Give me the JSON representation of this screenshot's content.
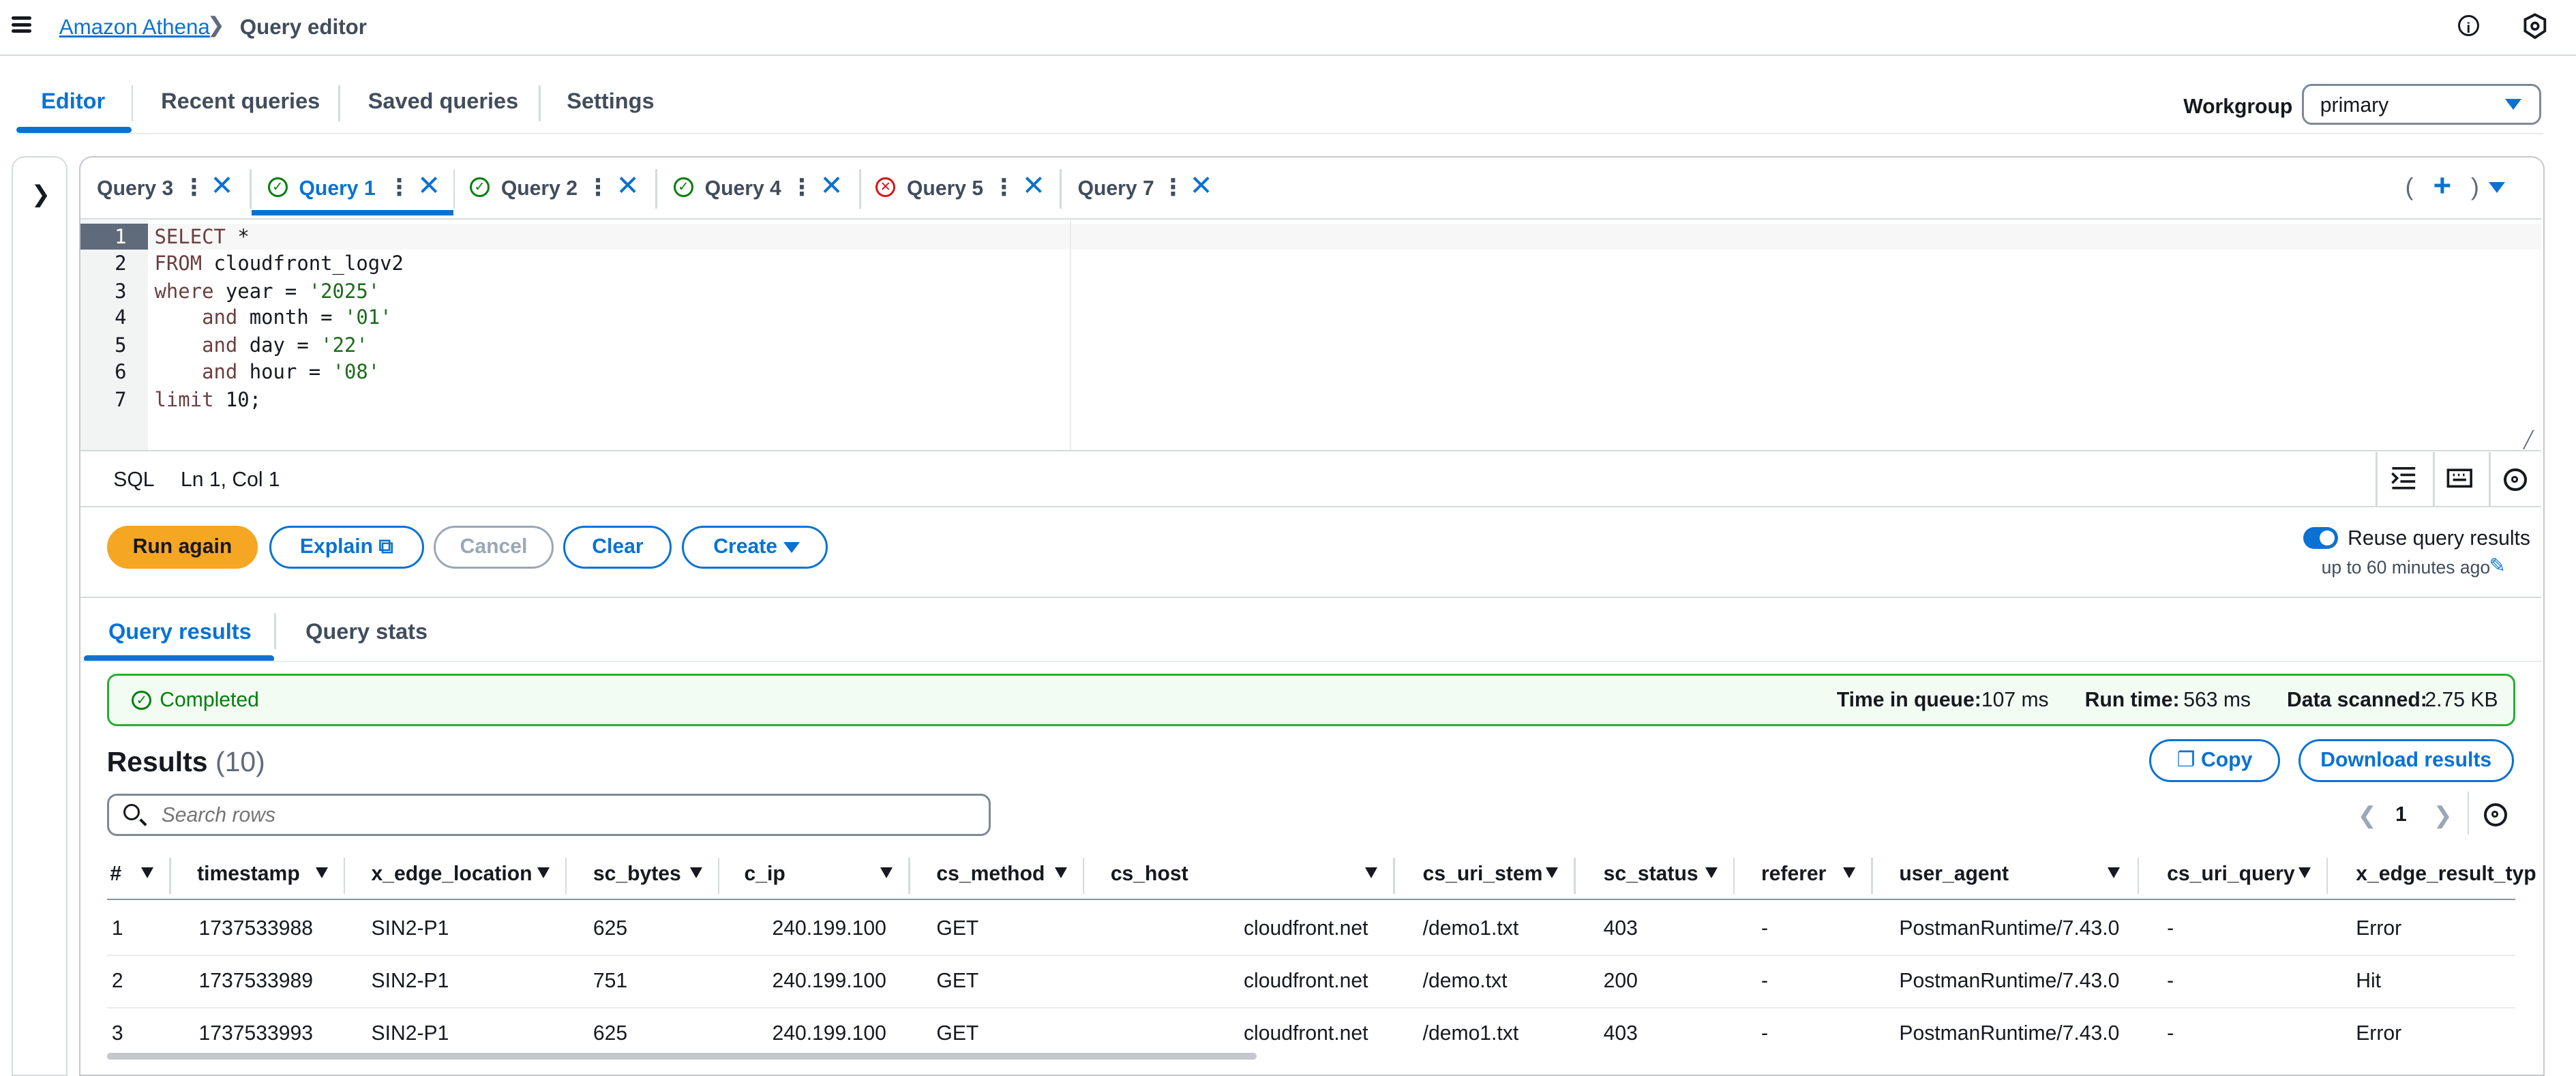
{
  "breadcrumb": {
    "root": "Amazon Athena",
    "current": "Query editor"
  },
  "main_tabs": [
    "Editor",
    "Recent queries",
    "Saved queries",
    "Settings"
  ],
  "workgroup": {
    "label": "Workgroup",
    "value": "primary"
  },
  "query_tabs": [
    {
      "label": "Query 3",
      "status": "none"
    },
    {
      "label": "Query 1",
      "status": "success"
    },
    {
      "label": "Query 2",
      "status": "success"
    },
    {
      "label": "Query 4",
      "status": "success"
    },
    {
      "label": "Query 5",
      "status": "error"
    },
    {
      "label": "Query 7",
      "status": "none"
    }
  ],
  "editor": {
    "line_numbers": [
      "1",
      "2",
      "3",
      "4",
      "5",
      "6",
      "7"
    ],
    "language": "SQL",
    "cursor": "Ln 1, Col 1"
  },
  "actions": {
    "run": "Run again",
    "explain": "Explain",
    "cancel": "Cancel",
    "clear": "Clear",
    "create": "Create",
    "reuse_label": "Reuse query results",
    "reuse_sub": "up to 60 minutes ago"
  },
  "result_tabs": [
    "Query results",
    "Query stats"
  ],
  "status": {
    "text": "Completed",
    "time_in_queue_label": "Time in queue:",
    "time_in_queue": "107 ms",
    "run_time_label": "Run time:",
    "run_time": "563 ms",
    "data_scanned_label": "Data scanned:",
    "data_scanned": "2.75 KB"
  },
  "results": {
    "title": "Results",
    "count": "(10)",
    "copy": "Copy",
    "download": "Download results",
    "search_placeholder": "Search rows",
    "page": "1",
    "columns": [
      "#",
      "timestamp",
      "x_edge_location",
      "sc_bytes",
      "c_ip",
      "cs_method",
      "cs_host",
      "cs_uri_stem",
      "sc_status",
      "referer",
      "user_agent",
      "cs_uri_query",
      "x_edge_result_typ"
    ],
    "rows": [
      [
        "1",
        "1737533988",
        "SIN2-P1",
        "625",
        "240.199.100",
        "GET",
        "cloudfront.net",
        "/demo1.txt",
        "403",
        "-",
        "PostmanRuntime/7.43.0",
        "-",
        "Error"
      ],
      [
        "2",
        "1737533989",
        "SIN2-P1",
        "751",
        "240.199.100",
        "GET",
        "cloudfront.net",
        "/demo.txt",
        "200",
        "-",
        "PostmanRuntime/7.43.0",
        "-",
        "Hit"
      ],
      [
        "3",
        "1737533993",
        "SIN2-P1",
        "625",
        "240.199.100",
        "GET",
        "cloudfront.net",
        "/demo1.txt",
        "403",
        "-",
        "PostmanRuntime/7.43.0",
        "-",
        "Error"
      ]
    ]
  },
  "colors": {
    "accent": "#0972d3",
    "run_button": "#f5a623",
    "success": "#037f0c",
    "error": "#d91515"
  }
}
